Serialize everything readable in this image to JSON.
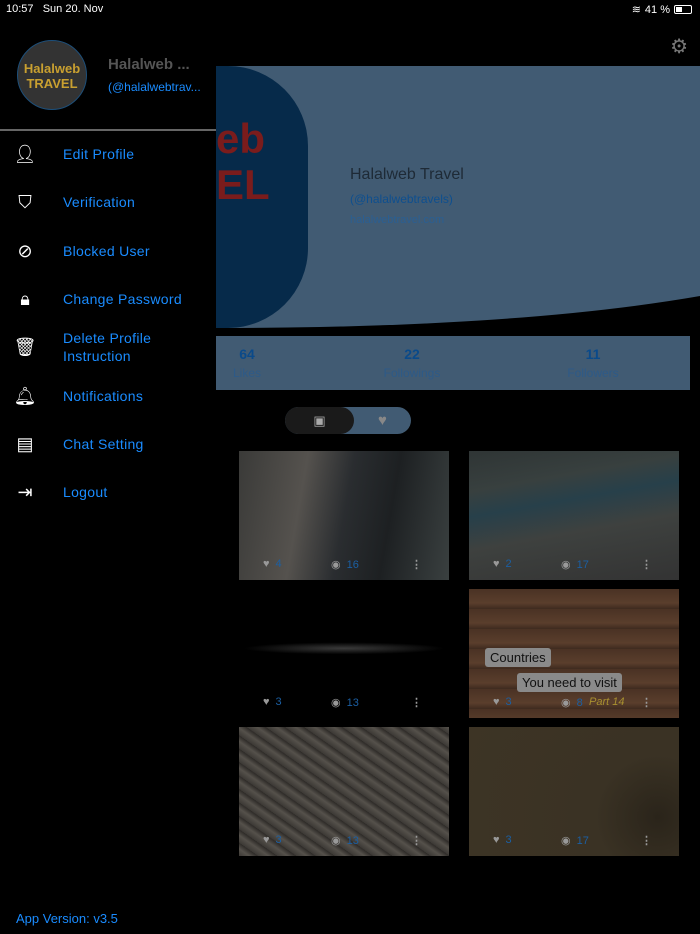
{
  "status": {
    "time": "10:57",
    "date": "Sun 20. Nov",
    "battery": "41 %"
  },
  "drawer": {
    "avatar_logo": "Halalweb TRAVEL",
    "name": "Halalweb ...",
    "handle": "(@halalwebtrav...",
    "items": [
      {
        "label": "Edit Profile",
        "icon": "person-icon"
      },
      {
        "label": "Verification",
        "icon": "shield-check-icon"
      },
      {
        "label": "Blocked User",
        "icon": "block-icon"
      },
      {
        "label": "Change Password",
        "icon": "lock-icon"
      },
      {
        "label": "Delete Profile Instruction",
        "icon": "delete-icon"
      },
      {
        "label": "Notifications",
        "icon": "bell-icon"
      },
      {
        "label": "Chat Setting",
        "icon": "chat-icon"
      },
      {
        "label": "Logout",
        "icon": "logout-icon"
      }
    ],
    "version": "App Version:  v3.5"
  },
  "profile": {
    "logo_text": "eb EL",
    "name": "Halalweb Travel",
    "handle": "(@halalwebtravels)",
    "website": "halalwebtravel.com"
  },
  "stats": [
    {
      "value": "64",
      "label": "Likes"
    },
    {
      "value": "22",
      "label": "Followings"
    },
    {
      "value": "11",
      "label": "Followers"
    }
  ],
  "videos": [
    {
      "likes": "4",
      "views": "16"
    },
    {
      "likes": "2",
      "views": "17"
    },
    {
      "likes": "3",
      "views": "13"
    },
    {
      "likes": "3",
      "views": "8",
      "overlay1": "Countries",
      "overlay2": "You need to visit",
      "tag": "Part 14"
    },
    {
      "likes": "3",
      "views": "13"
    },
    {
      "likes": "3",
      "views": "17"
    }
  ]
}
